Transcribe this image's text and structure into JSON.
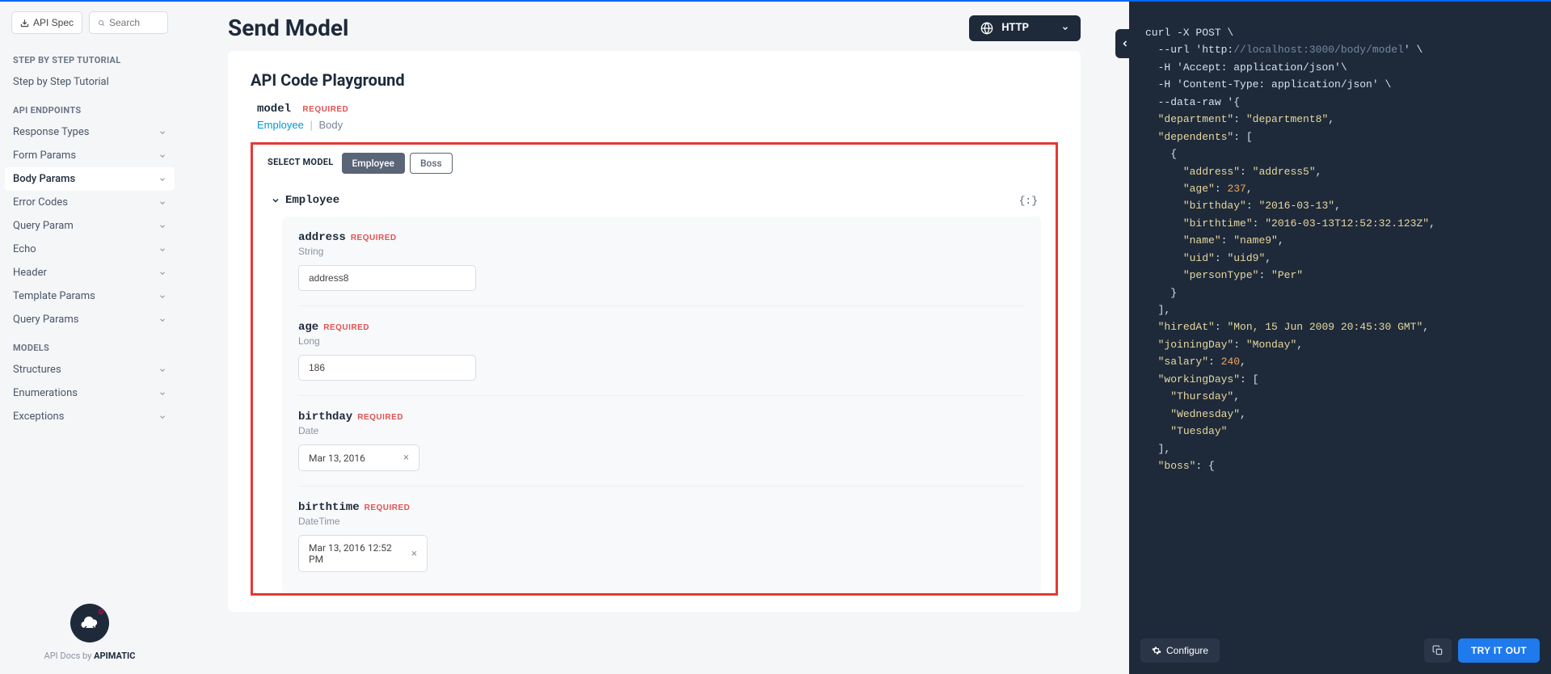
{
  "sidebar": {
    "apiSpecLabel": "API Spec",
    "searchPlaceholder": "Search",
    "sections": [
      {
        "label": "STEP BY STEP TUTORIAL",
        "items": [
          {
            "label": "Step by Step Tutorial",
            "expandable": false
          }
        ]
      },
      {
        "label": "API ENDPOINTS",
        "items": [
          {
            "label": "Response Types",
            "expandable": true
          },
          {
            "label": "Form Params",
            "expandable": true
          },
          {
            "label": "Body Params",
            "expandable": true,
            "active": true
          },
          {
            "label": "Error Codes",
            "expandable": true
          },
          {
            "label": "Query Param",
            "expandable": true
          },
          {
            "label": "Echo",
            "expandable": true
          },
          {
            "label": "Header",
            "expandable": true
          },
          {
            "label": "Template Params",
            "expandable": true
          },
          {
            "label": "Query Params",
            "expandable": true
          }
        ]
      },
      {
        "label": "MODELS",
        "items": [
          {
            "label": "Structures",
            "expandable": true
          },
          {
            "label": "Enumerations",
            "expandable": true
          },
          {
            "label": "Exceptions",
            "expandable": true
          }
        ]
      }
    ],
    "footerPrefix": "API Docs by ",
    "footerBrand": "APIMATIC"
  },
  "header": {
    "pageTitle": "Send Model",
    "httpLabel": "HTTP"
  },
  "playground": {
    "title": "API Code Playground",
    "modelLabel": "model",
    "requiredTag": "REQUIRED",
    "typeLink": "Employee",
    "typeBody": "Body",
    "selectModelLabel": "SELECT MODEL",
    "tabs": [
      {
        "label": "Employee",
        "active": true
      },
      {
        "label": "Boss",
        "active": false
      }
    ],
    "employeeHeader": "Employee",
    "bracesHint": "{:}",
    "fields": [
      {
        "name": "address",
        "required": true,
        "type": "String",
        "value": "address8",
        "kind": "text"
      },
      {
        "name": "age",
        "required": true,
        "type": "Long",
        "value": "186",
        "kind": "text"
      },
      {
        "name": "birthday",
        "required": true,
        "type": "Date",
        "value": "Mar 13, 2016",
        "kind": "date"
      },
      {
        "name": "birthtime",
        "required": true,
        "type": "DateTime",
        "value": "Mar 13, 2016 12:52 PM",
        "kind": "datetime"
      }
    ]
  },
  "code": {
    "lines": [
      {
        "segs": [
          {
            "t": "curl -X POST \\",
            "c": "tok-cmd"
          }
        ]
      },
      {
        "indent": 1,
        "segs": [
          {
            "t": "--url '",
            "c": "tok-flag"
          },
          {
            "t": "http:",
            "c": "tok-str"
          },
          {
            "t": "//localhost:3000/body/model",
            "c": "tok-url"
          },
          {
            "t": "' \\",
            "c": "tok-flag"
          }
        ]
      },
      {
        "indent": 1,
        "segs": [
          {
            "t": "-H 'Accept: application/json'\\",
            "c": "tok-flag"
          }
        ]
      },
      {
        "indent": 1,
        "segs": [
          {
            "t": "-H 'Content-Type: application/json' \\",
            "c": "tok-flag"
          }
        ]
      },
      {
        "indent": 1,
        "segs": [
          {
            "t": "--data-raw '{",
            "c": "tok-flag"
          }
        ]
      },
      {
        "indent": 1,
        "segs": [
          {
            "t": "\"department\"",
            "c": "tok-key"
          },
          {
            "t": ": ",
            "c": "tok-punct"
          },
          {
            "t": "\"department8\"",
            "c": "tok-val-str"
          },
          {
            "t": ",",
            "c": "tok-punct"
          }
        ]
      },
      {
        "indent": 1,
        "segs": [
          {
            "t": "\"dependents\"",
            "c": "tok-key"
          },
          {
            "t": ": [",
            "c": "tok-punct"
          }
        ]
      },
      {
        "indent": 2,
        "segs": [
          {
            "t": "{",
            "c": "tok-punct"
          }
        ]
      },
      {
        "indent": 3,
        "segs": [
          {
            "t": "\"address\"",
            "c": "tok-key"
          },
          {
            "t": ": ",
            "c": "tok-punct"
          },
          {
            "t": "\"address5\"",
            "c": "tok-val-str"
          },
          {
            "t": ",",
            "c": "tok-punct"
          }
        ]
      },
      {
        "indent": 3,
        "segs": [
          {
            "t": "\"age\"",
            "c": "tok-key"
          },
          {
            "t": ": ",
            "c": "tok-punct"
          },
          {
            "t": "237",
            "c": "tok-num"
          },
          {
            "t": ",",
            "c": "tok-punct"
          }
        ]
      },
      {
        "indent": 3,
        "segs": [
          {
            "t": "\"birthday\"",
            "c": "tok-key"
          },
          {
            "t": ": ",
            "c": "tok-punct"
          },
          {
            "t": "\"2016-03-13\"",
            "c": "tok-val-str"
          },
          {
            "t": ",",
            "c": "tok-punct"
          }
        ]
      },
      {
        "indent": 3,
        "segs": [
          {
            "t": "\"birthtime\"",
            "c": "tok-key"
          },
          {
            "t": ": ",
            "c": "tok-punct"
          },
          {
            "t": "\"2016-03-13T12:52:32.123Z\"",
            "c": "tok-val-str"
          },
          {
            "t": ",",
            "c": "tok-punct"
          }
        ]
      },
      {
        "indent": 3,
        "segs": [
          {
            "t": "\"name\"",
            "c": "tok-key"
          },
          {
            "t": ": ",
            "c": "tok-punct"
          },
          {
            "t": "\"name9\"",
            "c": "tok-val-str"
          },
          {
            "t": ",",
            "c": "tok-punct"
          }
        ]
      },
      {
        "indent": 3,
        "segs": [
          {
            "t": "\"uid\"",
            "c": "tok-key"
          },
          {
            "t": ": ",
            "c": "tok-punct"
          },
          {
            "t": "\"uid9\"",
            "c": "tok-val-str"
          },
          {
            "t": ",",
            "c": "tok-punct"
          }
        ]
      },
      {
        "indent": 3,
        "segs": [
          {
            "t": "\"personType\"",
            "c": "tok-key"
          },
          {
            "t": ": ",
            "c": "tok-punct"
          },
          {
            "t": "\"Per\"",
            "c": "tok-val-str"
          }
        ]
      },
      {
        "indent": 2,
        "segs": [
          {
            "t": "}",
            "c": "tok-punct"
          }
        ]
      },
      {
        "indent": 1,
        "segs": [
          {
            "t": "],",
            "c": "tok-punct"
          }
        ]
      },
      {
        "indent": 1,
        "segs": [
          {
            "t": "\"hiredAt\"",
            "c": "tok-key"
          },
          {
            "t": ": ",
            "c": "tok-punct"
          },
          {
            "t": "\"Mon, 15 Jun 2009 20:45:30 GMT\"",
            "c": "tok-val-str"
          },
          {
            "t": ",",
            "c": "tok-punct"
          }
        ]
      },
      {
        "indent": 1,
        "segs": [
          {
            "t": "\"joiningDay\"",
            "c": "tok-key"
          },
          {
            "t": ": ",
            "c": "tok-punct"
          },
          {
            "t": "\"Monday\"",
            "c": "tok-val-str"
          },
          {
            "t": ",",
            "c": "tok-punct"
          }
        ]
      },
      {
        "indent": 1,
        "segs": [
          {
            "t": "\"salary\"",
            "c": "tok-key"
          },
          {
            "t": ": ",
            "c": "tok-punct"
          },
          {
            "t": "240",
            "c": "tok-num"
          },
          {
            "t": ",",
            "c": "tok-punct"
          }
        ]
      },
      {
        "indent": 1,
        "segs": [
          {
            "t": "\"workingDays\"",
            "c": "tok-key"
          },
          {
            "t": ": [",
            "c": "tok-punct"
          }
        ]
      },
      {
        "indent": 2,
        "segs": [
          {
            "t": "\"Thursday\"",
            "c": "tok-val-str"
          },
          {
            "t": ",",
            "c": "tok-punct"
          }
        ]
      },
      {
        "indent": 2,
        "segs": [
          {
            "t": "\"Wednesday\"",
            "c": "tok-val-str"
          },
          {
            "t": ",",
            "c": "tok-punct"
          }
        ]
      },
      {
        "indent": 2,
        "segs": [
          {
            "t": "\"Tuesday\"",
            "c": "tok-val-str"
          }
        ]
      },
      {
        "indent": 1,
        "segs": [
          {
            "t": "],",
            "c": "tok-punct"
          }
        ]
      },
      {
        "indent": 1,
        "segs": [
          {
            "t": "\"boss\"",
            "c": "tok-key"
          },
          {
            "t": ": {",
            "c": "tok-punct"
          }
        ]
      }
    ],
    "configureLabel": "Configure",
    "tryLabel": "TRY IT OUT"
  }
}
